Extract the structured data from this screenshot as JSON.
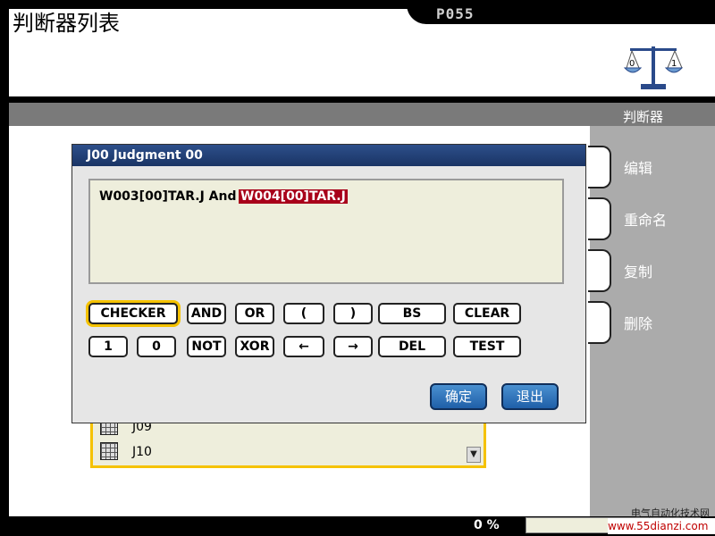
{
  "header": {
    "title": "判断器列表",
    "page_code": "P055"
  },
  "section": {
    "label": "判断器"
  },
  "side_menu": {
    "items": [
      "编辑",
      "重命名",
      "复制",
      "删除"
    ]
  },
  "list": {
    "items": [
      "J09",
      "J10"
    ]
  },
  "dialog": {
    "title": "J00 Judgment 00",
    "expression_normal": "W003[00]TAR.J And",
    "expression_selected": "W004[00]TAR.J",
    "keys_row1": [
      "CHECKER",
      "AND",
      "OR",
      "(",
      ")",
      "BS",
      "CLEAR"
    ],
    "keys_row2": [
      "1",
      "0",
      "NOT",
      "XOR",
      "←",
      "→",
      "DEL",
      "TEST"
    ],
    "ok_label": "确定",
    "exit_label": "退出"
  },
  "status": {
    "progress_text": "0 %",
    "progress": 0
  },
  "watermark": {
    "label": "电气自动化技术网",
    "url": "www.55dianzi.com"
  },
  "colors": {
    "accent_yellow": "#f5c200",
    "selection_red": "#a8001a",
    "title_blue": "#1a3465"
  }
}
